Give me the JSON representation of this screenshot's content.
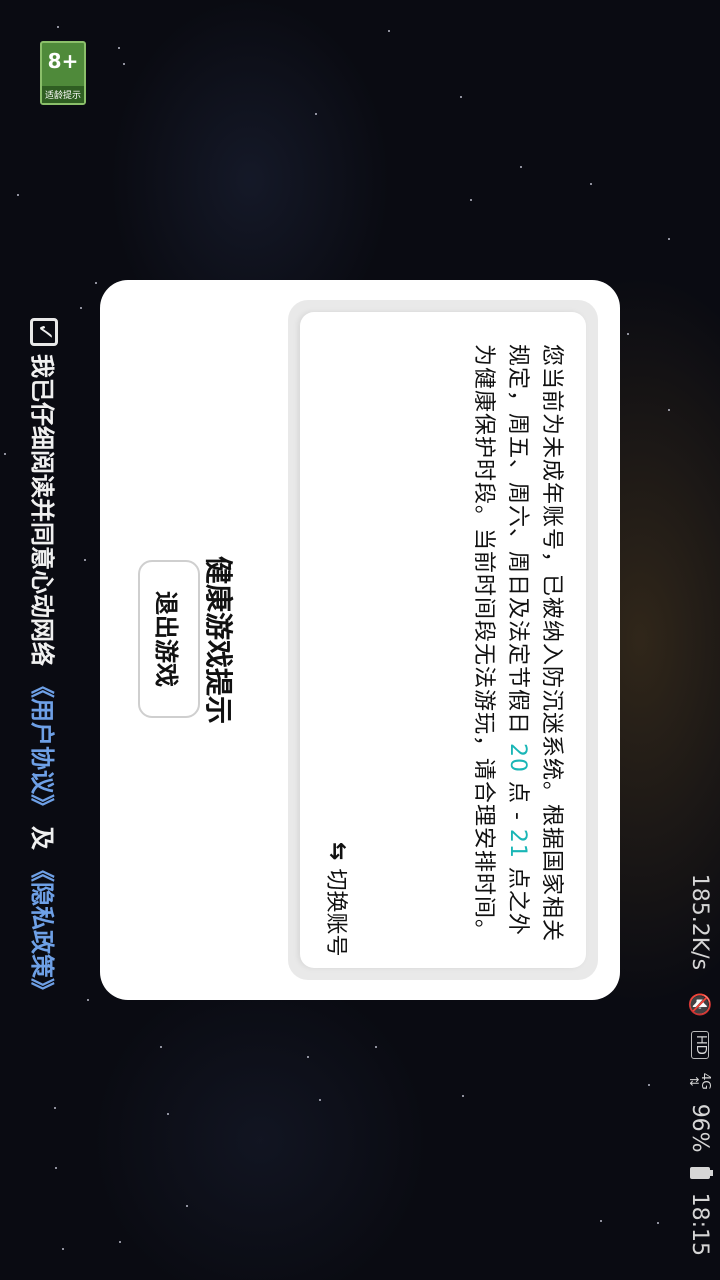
{
  "status_bar": {
    "time": "18:15",
    "battery": "96%",
    "network": "4G",
    "hd_badge": "HD",
    "net_speed": "185.2K/s",
    "icons": [
      "battery-icon",
      "signal-icon",
      "hd-icon",
      "mute-icon"
    ]
  },
  "age_rating": {
    "value": "8+",
    "tag": "适龄提示",
    "sub": "CADPA"
  },
  "agreement": {
    "prefix": "我已仔细阅读并同意心动网络",
    "user_agreement": "《用户协议》",
    "and": "及",
    "privacy_policy": "《隐私政策》"
  },
  "dialog": {
    "title": "健康游戏提示",
    "notice_part1": "您当前为未成年账号，已被纳入防沉迷系统。根据国家相关规定，周五、周六、周日及法定节假日 ",
    "hour_start": "20",
    "notice_part2": " 点 - ",
    "hour_end": "21",
    "notice_part3": " 点之外为健康保护时段。当前时间段无法游玩，请合理安排时间。",
    "switch_account": "切换账号",
    "exit_button": "退出游戏"
  },
  "colors": {
    "highlight": "#19b6b6",
    "link": "#6ea0e6",
    "age_badge": "#4f8a3a"
  }
}
